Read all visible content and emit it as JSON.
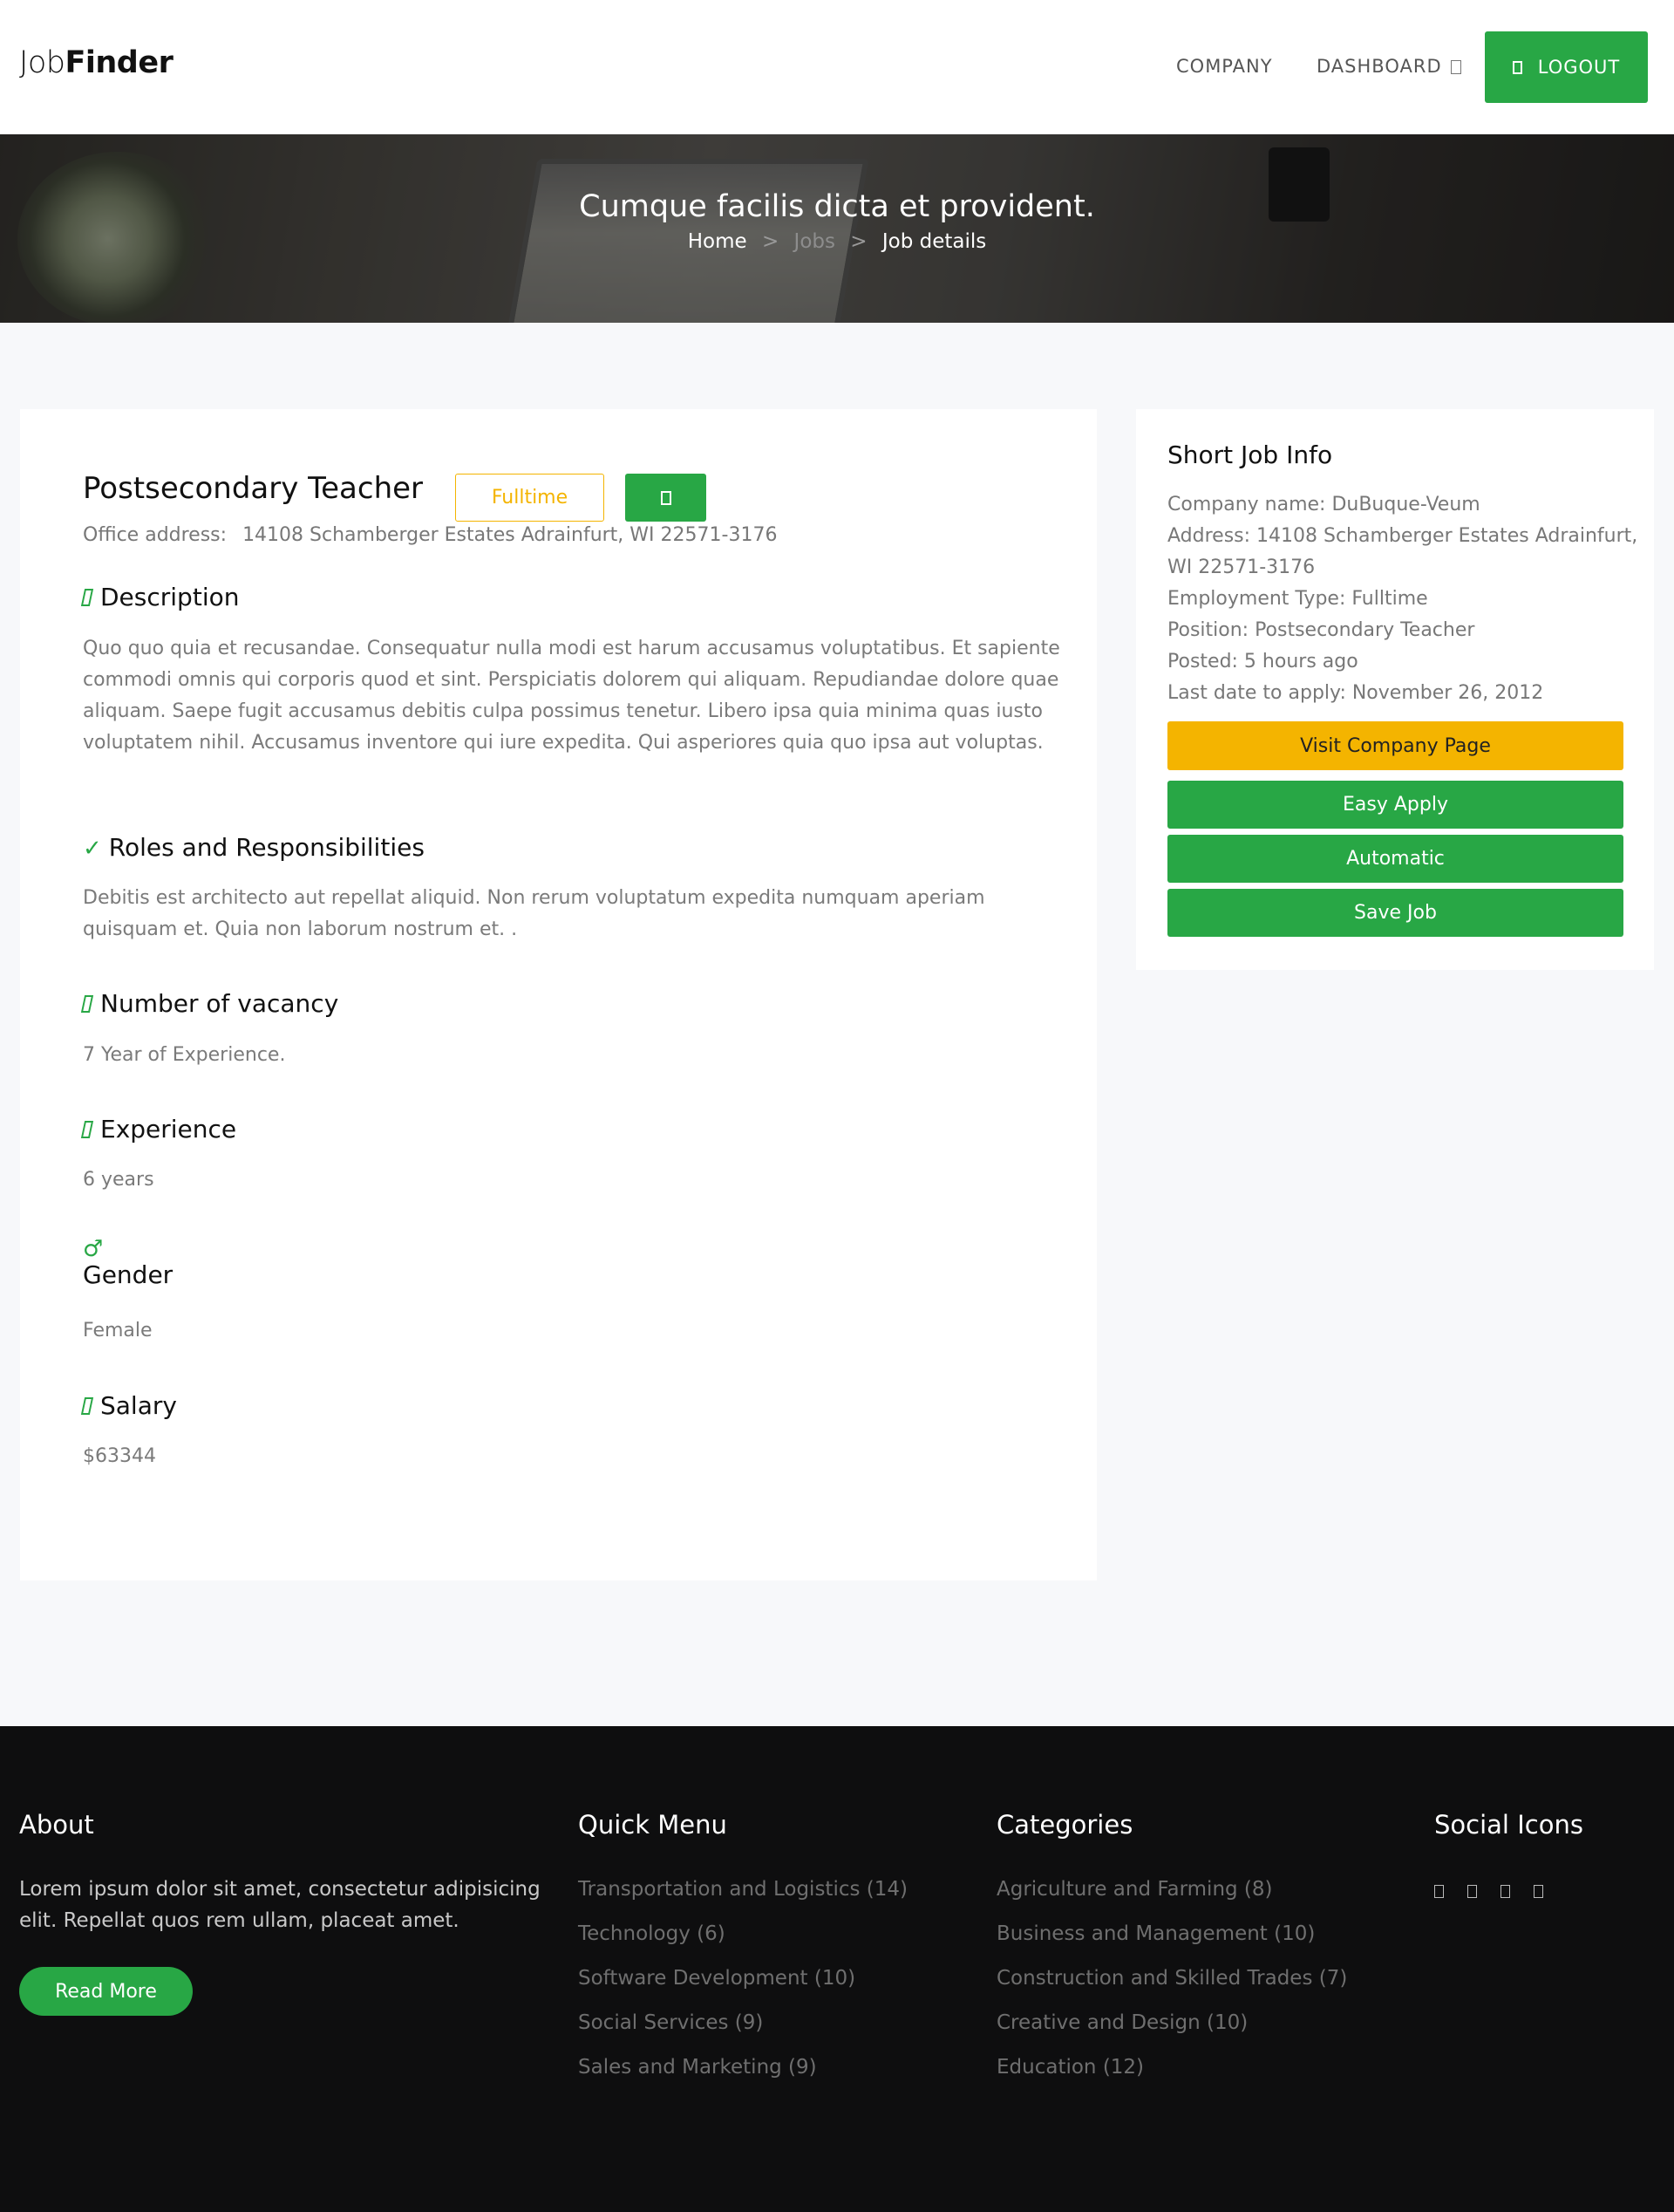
{
  "header": {
    "logo_light": "Job",
    "logo_bold": "Finder",
    "nav": {
      "company": "COMPANY",
      "dashboard": "DASHBOARD",
      "logout": "LOGOUT"
    }
  },
  "hero": {
    "title": "Cumque facilis dicta et provident.",
    "breadcrumb": {
      "home": "Home",
      "sep": ">",
      "jobs": "Jobs",
      "current": "Job details"
    }
  },
  "job": {
    "title": "Postsecondary Teacher",
    "type_badge": "Fulltime",
    "office_label": "Office address:",
    "office_address": "14108 Schamberger Estates Adrainfurt, WI 22571-3176",
    "sections": {
      "description": {
        "title": "Description",
        "text": "Quo quo quia et recusandae. Consequatur nulla modi est harum accusamus voluptatibus. Et sapiente commodi omnis qui corporis quod et sint. Perspiciatis dolorem qui aliquam. Repudiandae dolore quae aliquam. Saepe fugit accusamus debitis culpa possimus tenetur. Libero ipsa quia minima quas iusto voluptatem nihil. Accusamus inventore qui iure expedita. Qui asperiores quia quo ipsa aut voluptas."
      },
      "roles": {
        "title": "Roles and Responsibilities",
        "text": "Debitis est architecto aut repellat aliquid. Non rerum voluptatum expedita numquam aperiam quisquam et. Quia non laborum nostrum et. ."
      },
      "vacancy": {
        "title": "Number of vacancy",
        "text": "7 Year of Experience."
      },
      "experience": {
        "title": "Experience",
        "text": "6 years"
      },
      "gender": {
        "title": "Gender",
        "text": "Female"
      },
      "salary": {
        "title": "Salary",
        "text": "$63344"
      }
    }
  },
  "sidebar": {
    "title": "Short Job Info",
    "info": [
      "Company name: DuBuque-Veum",
      "Address: 14108 Schamberger Estates Adrainfurt, WI 22571-3176",
      "Employment Type: Fulltime",
      "Position: Postsecondary Teacher",
      "Posted: 5 hours ago",
      "Last date to apply: November 26, 2012"
    ],
    "buttons": {
      "visit": "Visit Company Page",
      "easy_apply": "Easy Apply",
      "automatic": "Automatic",
      "save": "Save Job"
    }
  },
  "footer": {
    "about": {
      "title": "About",
      "text": "Lorem ipsum dolor sit amet, consectetur adipisicing elit. Repellat quos rem ullam, placeat amet.",
      "button": "Read More"
    },
    "quick_menu": {
      "title": "Quick Menu",
      "items": [
        "Transportation and Logistics (14)",
        "Technology (6)",
        "Software Development (10)",
        "Social Services (9)",
        "Sales and Marketing (9)"
      ]
    },
    "categories": {
      "title": "Categories",
      "items": [
        "Agriculture and Farming (8)",
        "Business and Management (10)",
        "Construction and Skilled Trades (7)",
        "Creative and Design (10)",
        "Education (12)"
      ]
    },
    "social": {
      "title": "Social Icons",
      "icons": [
        "facebook-icon",
        "twitter-icon",
        "instagram-icon",
        "linkedin-icon"
      ]
    }
  },
  "colors": {
    "accent_green": "#28a745",
    "accent_yellow": "#f4b400",
    "footer_bg": "#0e0e0f"
  }
}
